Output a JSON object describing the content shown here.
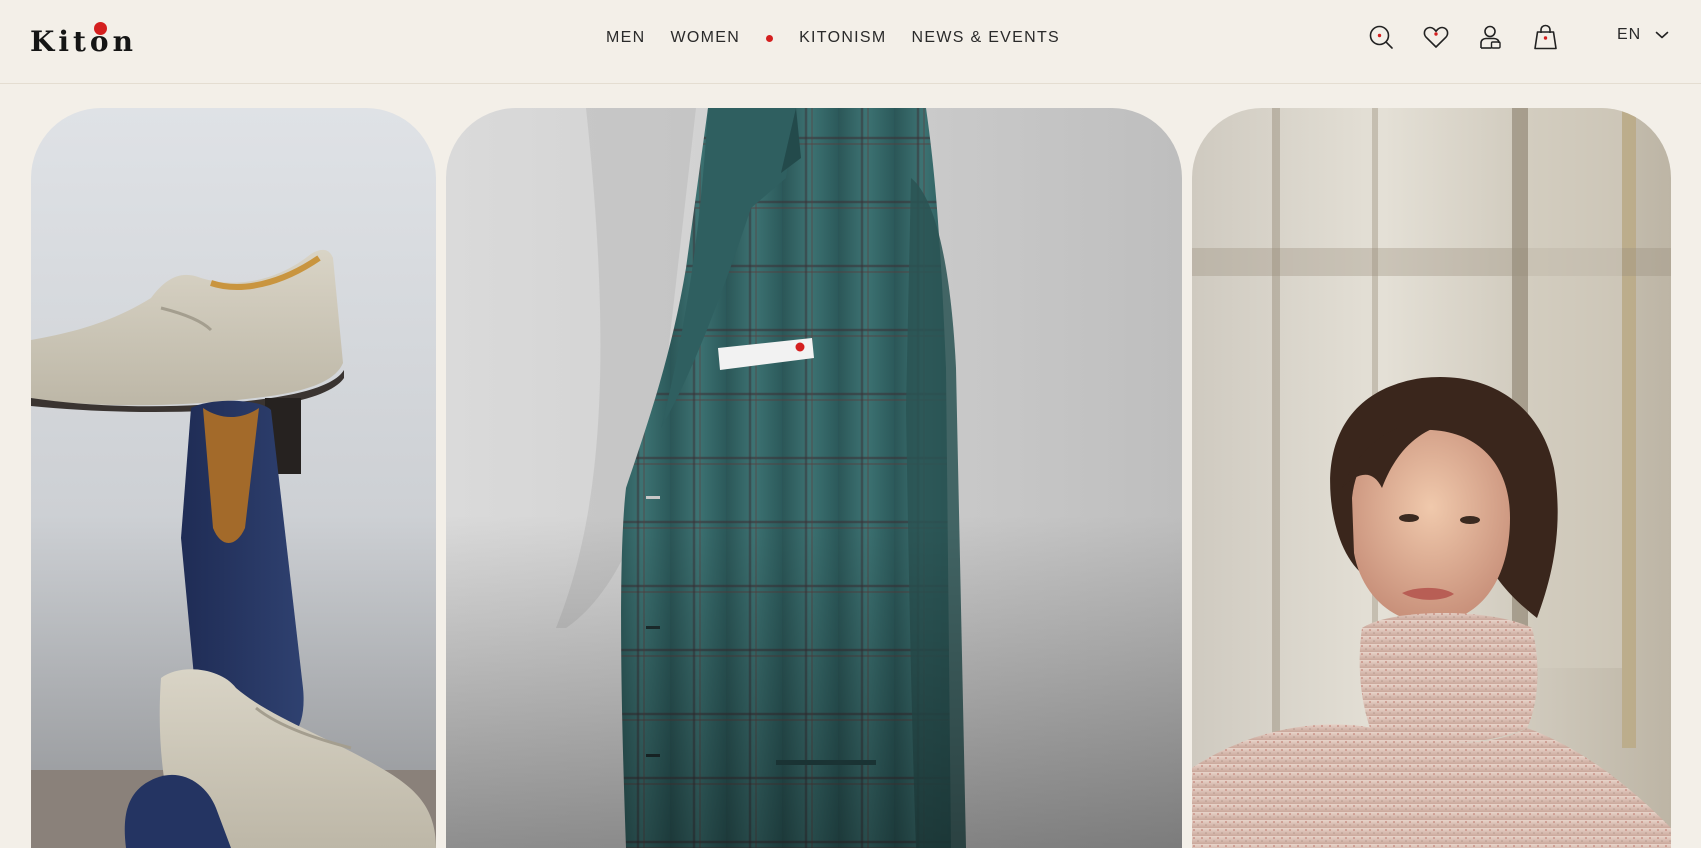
{
  "brand": {
    "name": "Kiton",
    "accent_color": "#d41f1f"
  },
  "nav": {
    "items": [
      {
        "label": "MEN"
      },
      {
        "label": "WOMEN"
      },
      {
        "label": "KITONISM"
      },
      {
        "label": "NEWS & EVENTS"
      }
    ]
  },
  "header_icons": [
    "search-icon",
    "heart-icon",
    "account-icon",
    "shopping-bag-icon"
  ],
  "language": {
    "current": "EN"
  },
  "tiles": [
    {
      "subject": "stacked-suede-loafers"
    },
    {
      "subject": "teal-check-jacket"
    },
    {
      "subject": "woman-knit-turtleneck"
    }
  ],
  "colors": {
    "background": "#f3efe8",
    "text": "#2a2a2a"
  }
}
